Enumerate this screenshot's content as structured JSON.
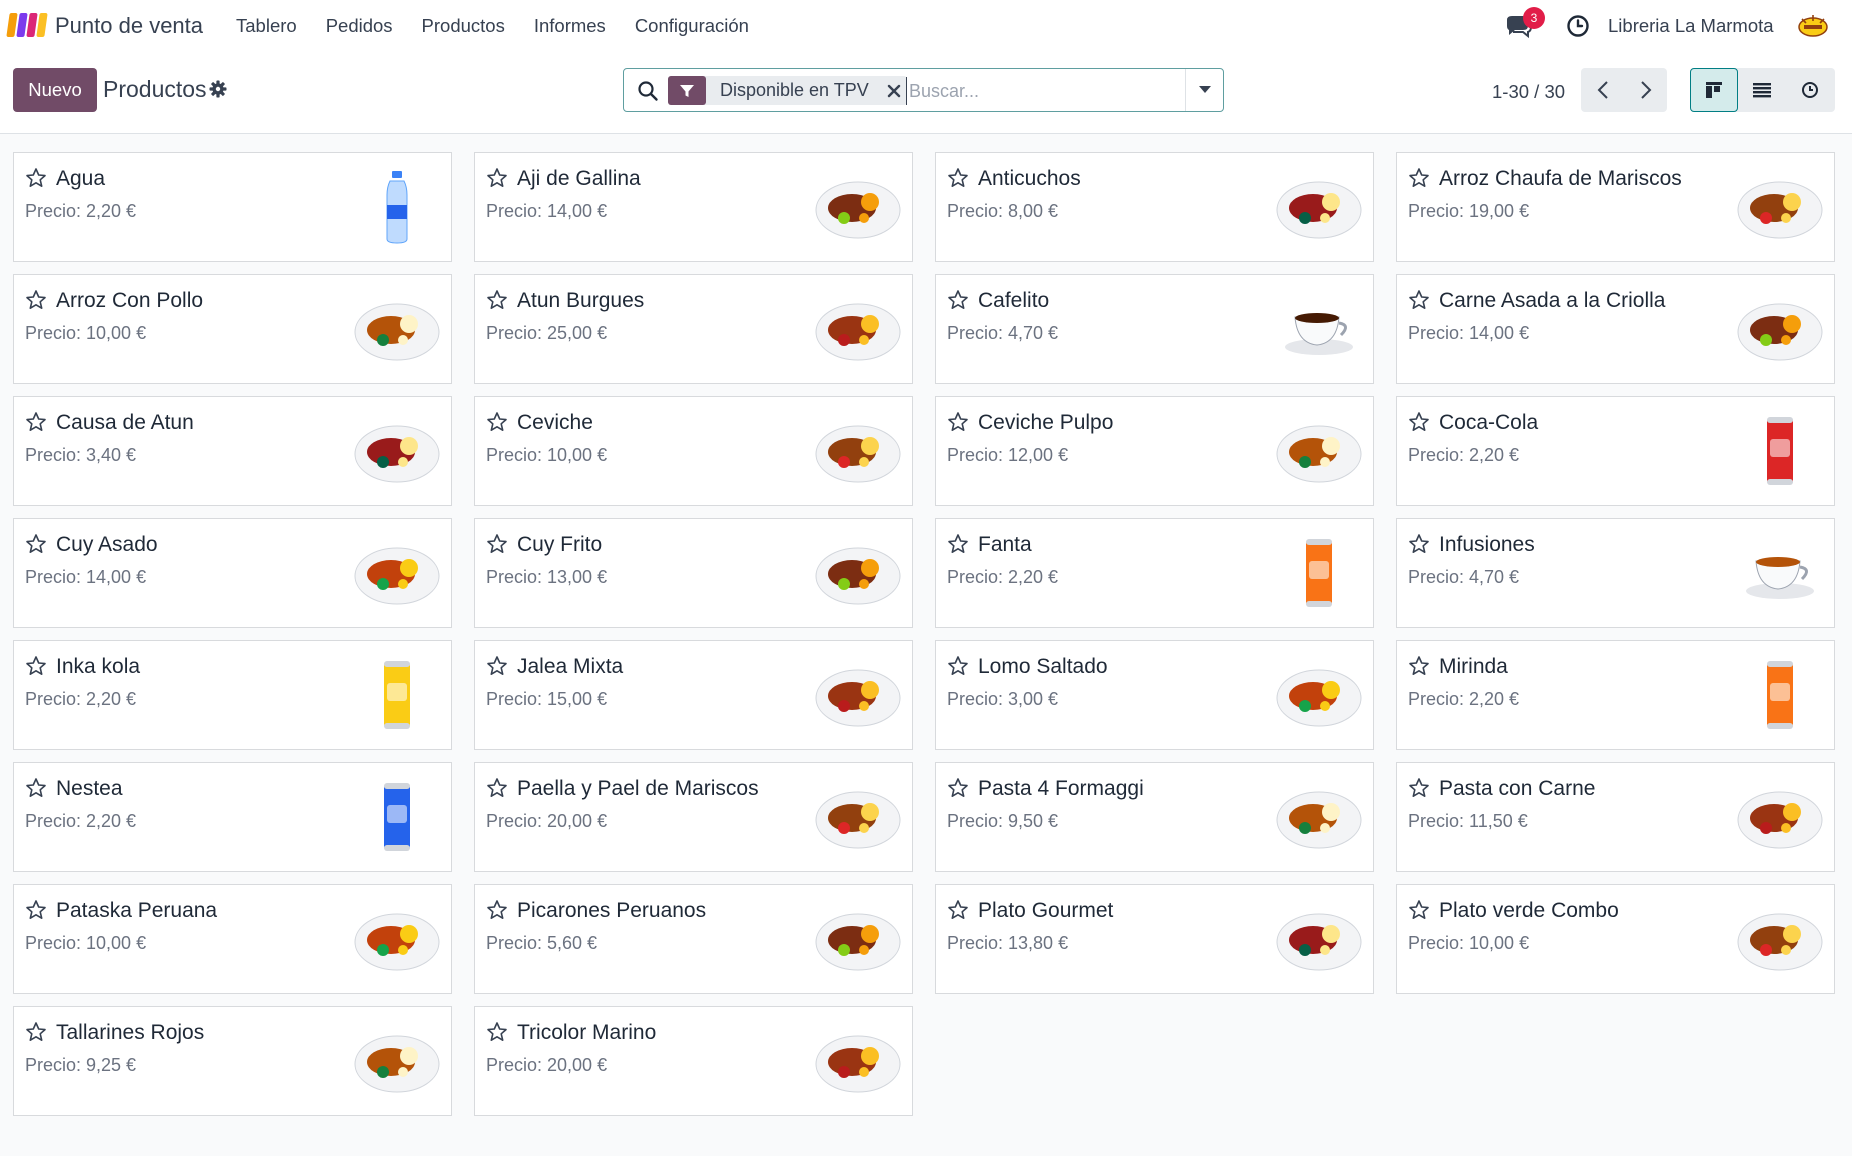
{
  "navbar": {
    "app_name": "Punto de venta",
    "menu": [
      "Tablero",
      "Pedidos",
      "Productos",
      "Informes",
      "Configuración"
    ],
    "chat_count": "3",
    "company": "Libreria La Marmota",
    "logo_colors": [
      "#f59e0b",
      "#7c3aed",
      "#db2777",
      "#fbbf24"
    ]
  },
  "control_panel": {
    "new_label": "Nuevo",
    "title": "Productos",
    "search": {
      "facet_label": "Disponible en TPV",
      "placeholder": "Buscar..."
    },
    "pager": "1-30 / 30"
  },
  "colors": {
    "brand": "#714b67",
    "accent": "#017e84"
  },
  "products": [
    {
      "name": "Agua",
      "price": "Precio: 2,20 €",
      "icon": "bottle"
    },
    {
      "name": "Aji de Gallina",
      "price": "Precio: 14,00 €",
      "icon": "plate"
    },
    {
      "name": "Anticuchos",
      "price": "Precio: 8,00 €",
      "icon": "plate"
    },
    {
      "name": "Arroz Chaufa de Mariscos",
      "price": "Precio: 19,00 €",
      "icon": "plate"
    },
    {
      "name": "Arroz Con Pollo",
      "price": "Precio: 10,00 €",
      "icon": "plate"
    },
    {
      "name": "Atun Burgues",
      "price": "Precio: 25,00 €",
      "icon": "plate"
    },
    {
      "name": "Cafelito",
      "price": "Precio: 4,70 €",
      "icon": "cup"
    },
    {
      "name": "Carne Asada a la Criolla",
      "price": "Precio: 14,00 €",
      "icon": "plate"
    },
    {
      "name": "Causa de Atun",
      "price": "Precio: 3,40 €",
      "icon": "plate"
    },
    {
      "name": "Ceviche",
      "price": "Precio: 10,00 €",
      "icon": "plate"
    },
    {
      "name": "Ceviche Pulpo",
      "price": "Precio: 12,00 €",
      "icon": "plate"
    },
    {
      "name": "Coca-Cola",
      "price": "Precio: 2,20 €",
      "icon": "can-red"
    },
    {
      "name": "Cuy Asado",
      "price": "Precio: 14,00 €",
      "icon": "plate"
    },
    {
      "name": "Cuy Frito",
      "price": "Precio: 13,00 €",
      "icon": "plate"
    },
    {
      "name": "Fanta",
      "price": "Precio: 2,20 €",
      "icon": "can-orange"
    },
    {
      "name": "Infusiones",
      "price": "Precio: 4,70 €",
      "icon": "cup"
    },
    {
      "name": "Inka kola",
      "price": "Precio: 2,20 €",
      "icon": "can-yellow"
    },
    {
      "name": "Jalea Mixta",
      "price": "Precio: 15,00 €",
      "icon": "plate"
    },
    {
      "name": "Lomo Saltado",
      "price": "Precio: 3,00 €",
      "icon": "plate"
    },
    {
      "name": "Mirinda",
      "price": "Precio: 2,20 €",
      "icon": "can-orange"
    },
    {
      "name": "Nestea",
      "price": "Precio: 2,20 €",
      "icon": "can-blue"
    },
    {
      "name": "Paella y Pael de Mariscos",
      "price": "Precio: 20,00 €",
      "icon": "plate"
    },
    {
      "name": "Pasta 4 Formaggi",
      "price": "Precio: 9,50 €",
      "icon": "plate"
    },
    {
      "name": "Pasta con Carne",
      "price": "Precio: 11,50 €",
      "icon": "plate"
    },
    {
      "name": "Pataska Peruana",
      "price": "Precio: 10,00 €",
      "icon": "plate"
    },
    {
      "name": "Picarones Peruanos",
      "price": "Precio: 5,60 €",
      "icon": "plate"
    },
    {
      "name": "Plato Gourmet",
      "price": "Precio: 13,80 €",
      "icon": "plate"
    },
    {
      "name": "Plato verde Combo",
      "price": "Precio: 10,00 €",
      "icon": "plate"
    },
    {
      "name": "Tallarines Rojos",
      "price": "Precio: 9,25 €",
      "icon": "plate"
    },
    {
      "name": "Tricolor Marino",
      "price": "Precio: 20,00 €",
      "icon": "plate"
    }
  ]
}
